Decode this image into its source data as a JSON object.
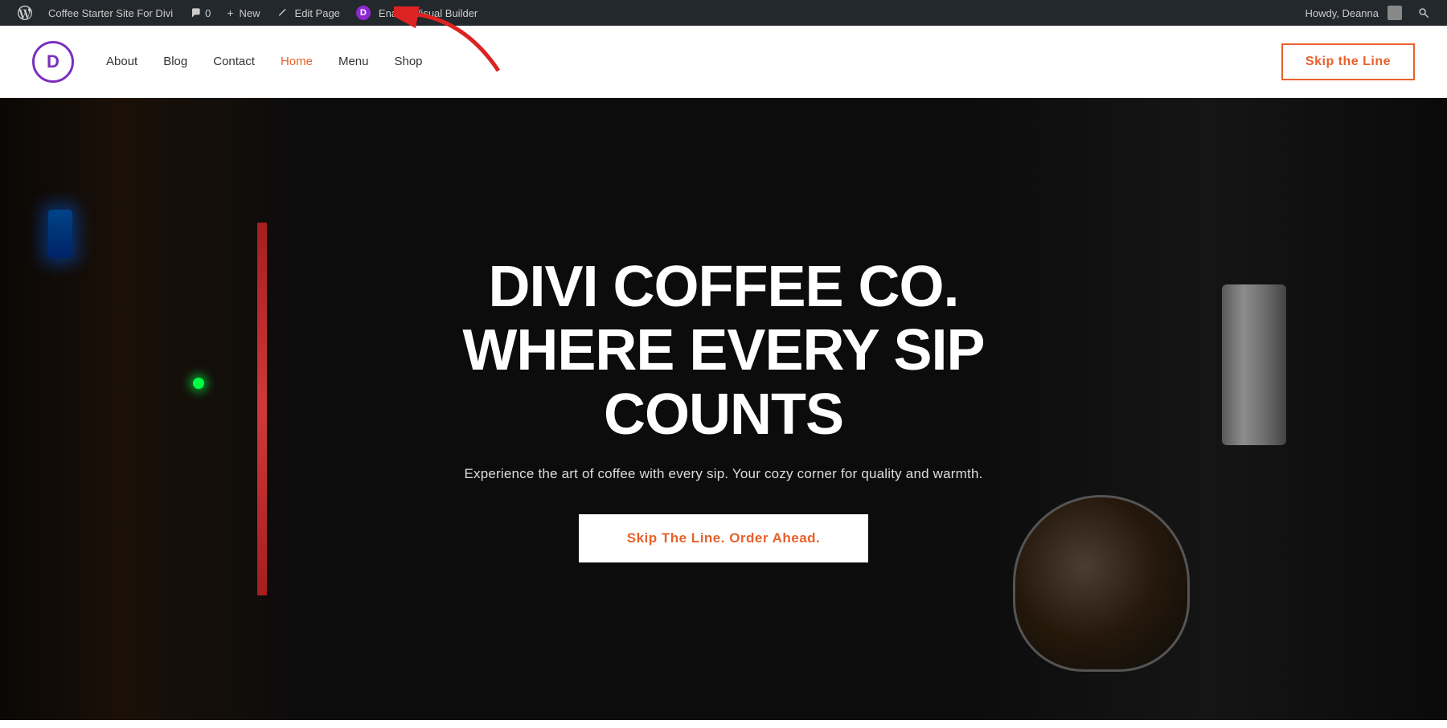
{
  "adminBar": {
    "siteTitle": "Coffee Starter Site For Divi",
    "commentsLabel": "0",
    "newLabel": "New",
    "editPageLabel": "Edit Page",
    "enableVisualBuilderLabel": "Enable Visual Builder",
    "howdyLabel": "Howdy, Deanna"
  },
  "header": {
    "logoLetter": "D",
    "nav": {
      "about": "About",
      "blog": "Blog",
      "contact": "Contact",
      "home": "Home",
      "menu": "Menu",
      "shop": "Shop"
    },
    "ctaLabel": "Skip the Line"
  },
  "hero": {
    "title": "DIVI COFFEE CO. WHERE EVERY SIP COUNTS",
    "subtitle": "Experience the art of coffee with every sip. Your cozy corner for quality and warmth.",
    "ctaLabel": "Skip The Line. Order Ahead.",
    "accentColor": "#e8612c"
  },
  "icons": {
    "wordpress": "⊞",
    "comments": "💬",
    "plus": "+",
    "pencil": "✏",
    "divi": "D",
    "search": "🔍"
  }
}
